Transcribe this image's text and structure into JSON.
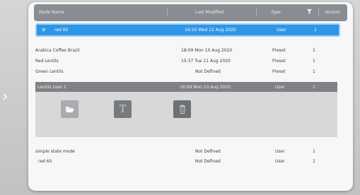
{
  "header": {
    "mode_name": "Mode Name",
    "last_modified": "Last Modified",
    "type": "Type",
    "version": "Version"
  },
  "selected_row": {
    "name": "red 65",
    "modified": "16:50 Wed 12 Aug 2020",
    "type": "User",
    "version": "1"
  },
  "rows": [
    {
      "name": "Arabica Coffee Brazil",
      "modified": "18:09 Mon 10 Aug 2020",
      "type": "Preset",
      "version": "1"
    },
    {
      "name": "Red Lentils",
      "modified": "15:37 Tue 11 Aug 2020",
      "type": "Preset",
      "version": "1"
    },
    {
      "name": "Green Lentils",
      "modified": "Not Defined",
      "type": "Preset",
      "version": "1"
    },
    {
      "name": "Lentils User 1",
      "modified": "16:09 Mon 10 Aug 2020",
      "type": "User",
      "version": "1"
    },
    {
      "name": "simple state mode",
      "modified": "Not Defined",
      "type": "User",
      "version": "1"
    },
    {
      "name": "red 60",
      "modified": "Not Defined",
      "type": "User",
      "version": "1"
    }
  ],
  "actions": {
    "rename_glyph": "T"
  },
  "icons": {
    "filter": "filter-icon",
    "open": "open-folder-icon",
    "delete": "trash-icon",
    "menu": "menu-icon"
  },
  "colors": {
    "selected": "#2f95e6",
    "header": "#898d93",
    "expanded_row": "#7f8184"
  }
}
